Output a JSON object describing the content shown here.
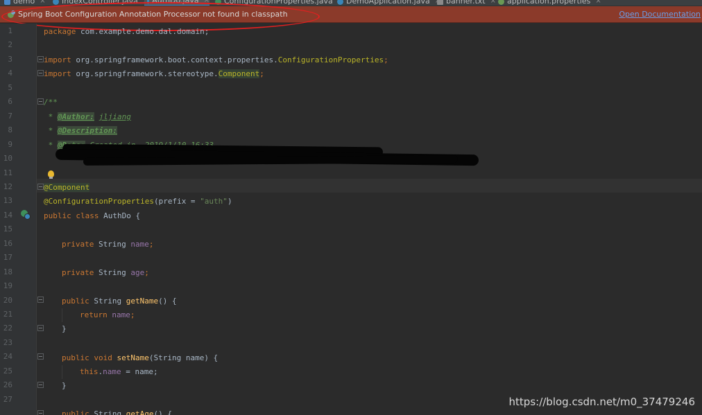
{
  "tabs": [
    {
      "label": "demo",
      "icon": "module-icon",
      "color": "#4a88c7",
      "active": false
    },
    {
      "label": "IndexController.java",
      "icon": "class-icon",
      "color": "#3a86b8",
      "active": false
    },
    {
      "label": "AuthDo.java",
      "icon": "class-icon",
      "color": "#3a86b8",
      "active": true
    },
    {
      "label": "ConfigurationProperties.java",
      "icon": "annotation-icon",
      "color": "#3e8f5a",
      "active": false
    },
    {
      "label": "DemoApplication.java",
      "icon": "class-icon",
      "color": "#3a86b8",
      "active": false
    },
    {
      "label": "banner.txt",
      "icon": "text-file-icon",
      "color": "#8a8a8a",
      "active": false
    },
    {
      "label": "application.properties",
      "icon": "properties-icon",
      "color": "#6a9955",
      "active": false
    }
  ],
  "banner": {
    "message": "Spring Boot Configuration Annotation Processor not found in classpath",
    "link": "Open Documentation",
    "background": "#8b3a2a"
  },
  "line_numbers": [
    "1",
    "2",
    "3",
    "4",
    "5",
    "6",
    "7",
    "8",
    "9",
    "10",
    "11",
    "12",
    "13",
    "14",
    "15",
    "16",
    "17",
    "18",
    "19",
    "20",
    "21",
    "22",
    "23",
    "24",
    "25",
    "26",
    "27"
  ],
  "code": {
    "l1_kw": "package",
    "l1_rest": " com.example.demo.dal.domain;",
    "l3_kw": "import",
    "l3_pkg": " org.springframework.boot.context.properties.",
    "l3_cls": "ConfigurationProperties",
    "l3_end": ";",
    "l4_kw": "import",
    "l4_pkg": " org.springframework.stereotype.",
    "l4_cls": "Component",
    "l4_end": ";",
    "l6": "/**",
    "l7_star": " * ",
    "l7_tag": "@Author:",
    "l7_val": "jljiang",
    "l8_star": " * ",
    "l8_tag": "@Description:",
    "l9_star": " * ",
    "l9_tag": "@Date:",
    "l9_val": " Created in  2019/1/10 16:33",
    "l12": "@Component",
    "l13_ann": "@ConfigurationProperties",
    "l13_open": "(prefix = ",
    "l13_str": "\"auth\"",
    "l13_close": ")",
    "l14_kw": "public class",
    "l14_rest": " AuthDo {",
    "l16_kw": "private",
    "l16_type": " String ",
    "l16_fld": "name",
    "l16_end": ";",
    "l18_kw": "private",
    "l18_type": " String ",
    "l18_fld": "age",
    "l18_end": ";",
    "l20_kw": "public",
    "l20_type": " String ",
    "l20_mth": "getName",
    "l20_rest": "() {",
    "l21_kw": "return",
    "l21_sp": " ",
    "l21_fld": "name",
    "l21_end": ";",
    "l22": "}",
    "l24_kw": "public void",
    "l24_sp": " ",
    "l24_mth": "setName",
    "l24_rest": "(String name) {",
    "l25_kw": "this",
    "l25_dot": ".",
    "l25_fld": "name",
    "l25_rest": " = name;",
    "l26": "}",
    "l28_kw": "public",
    "l28_type": " String ",
    "l28_mth": "getAge",
    "l28_rest": "() {"
  },
  "watermark": "https://blog.csdn.net/m0_37479246"
}
